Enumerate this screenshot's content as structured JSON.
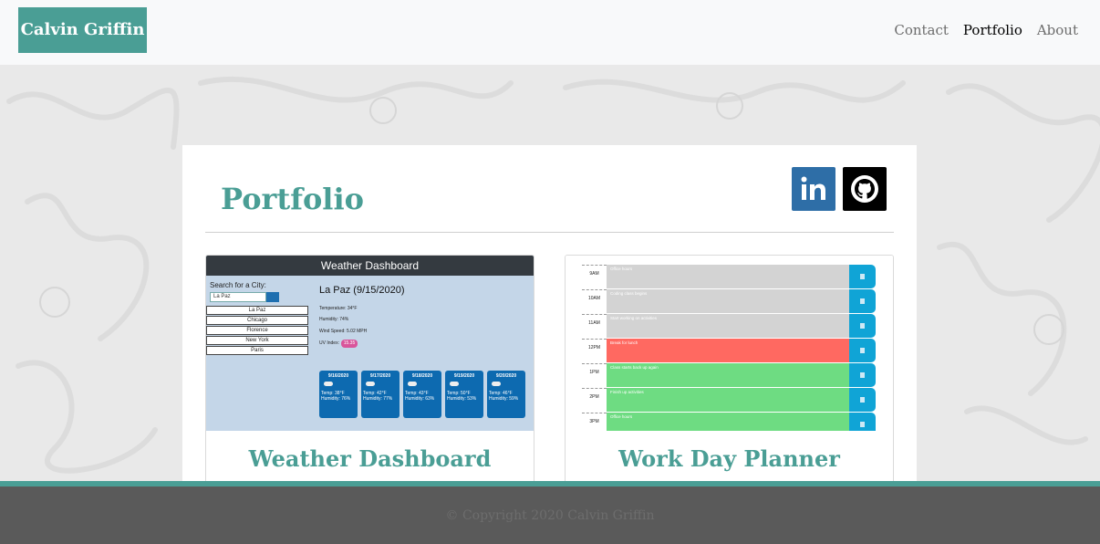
{
  "navbar": {
    "brand": "Calvin Griffin",
    "links": [
      {
        "label": "Contact",
        "active": false
      },
      {
        "label": "Portfolio",
        "active": true
      },
      {
        "label": "About",
        "active": false
      }
    ]
  },
  "page": {
    "title": "Portfolio",
    "social": [
      {
        "name": "linkedin-icon",
        "label": "in"
      },
      {
        "name": "github-icon"
      }
    ]
  },
  "projects": [
    {
      "title": "Weather Dashboard",
      "thumb": {
        "header": "Weather Dashboard",
        "search_label": "Search for a City:",
        "search_value": "La Paz",
        "cities": [
          "La Paz",
          "Chicago",
          "Florence",
          "New York",
          "Paris"
        ],
        "current_city": "La Paz (9/15/2020)",
        "stats": [
          "Temperature: 34°F",
          "Humidity: 74%",
          "Wind Speed: 5.02 MPH",
          "UV Index:"
        ],
        "uv": "15.35",
        "forecast": [
          {
            "date": "9/16/2020",
            "temp": "Temp: 38°F",
            "hum": "Humidity: 76%"
          },
          {
            "date": "9/17/2020",
            "temp": "Temp: 42°F",
            "hum": "Humidity: 77%"
          },
          {
            "date": "9/18/2020",
            "temp": "Temp: 43°F",
            "hum": "Humidity: 63%"
          },
          {
            "date": "9/19/2020",
            "temp": "Temp: 50°F",
            "hum": "Humidity: 53%"
          },
          {
            "date": "9/20/2020",
            "temp": "Temp: 46°F",
            "hum": "Humidity: 59%"
          }
        ]
      }
    },
    {
      "title": "Work Day Planner",
      "thumb": {
        "rows": [
          {
            "hour": "9AM",
            "task": "Office hours",
            "state": "past",
            "color": "#d3d3d3"
          },
          {
            "hour": "10AM",
            "task": "Coding class begins",
            "state": "past",
            "color": "#d3d3d3"
          },
          {
            "hour": "11AM",
            "task": "Start working on activities",
            "state": "past",
            "color": "#d3d3d3"
          },
          {
            "hour": "12PM",
            "task": "Break for lunch",
            "state": "present",
            "color": "#ff6961"
          },
          {
            "hour": "1PM",
            "task": "Class starts back up again",
            "state": "future",
            "color": "#6edc82"
          },
          {
            "hour": "2PM",
            "task": "Finish up activities",
            "state": "future",
            "color": "#6edc82"
          },
          {
            "hour": "3PM",
            "task": "Office hours",
            "state": "future",
            "color": "#6edc82"
          }
        ]
      }
    }
  ],
  "footer": {
    "copyright": "© Copyright 2020 Calvin Griffin"
  },
  "colors": {
    "accent": "#4a9e95",
    "linkedin": "#2e6ea7",
    "footer_bg": "#5a5a5a"
  }
}
